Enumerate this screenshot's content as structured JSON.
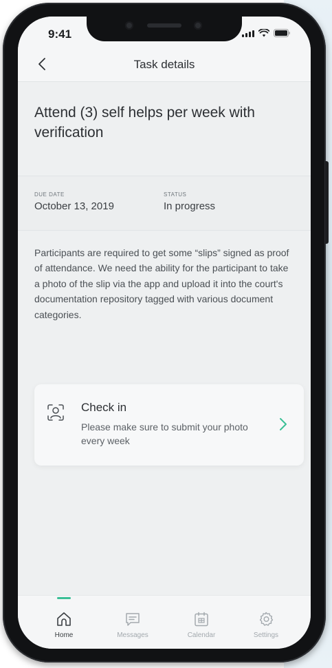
{
  "status_bar": {
    "time": "9:41"
  },
  "nav": {
    "title": "Task details",
    "back_icon": "chevron-left-icon"
  },
  "task": {
    "title": "Attend (3) self helps per week with verification",
    "due_date_label": "DUE DATE",
    "due_date_value": "October 13, 2019",
    "status_label": "STATUS",
    "status_value": "In progress",
    "description": "Participants are required to get some “slips” signed as proof of attendance. We need the ability for the participant to take a photo of the slip via the app and upload it into the court's documentation repository tagged with various document categories."
  },
  "checkin": {
    "title": "Check in",
    "subtitle": "Please make sure to submit your photo every week",
    "icon": "face-scan-icon",
    "action_icon": "chevron-right-icon"
  },
  "tabs": [
    {
      "label": "Home",
      "icon": "home-icon",
      "active": true
    },
    {
      "label": "Messages",
      "icon": "message-icon",
      "active": false
    },
    {
      "label": "Calendar",
      "icon": "calendar-icon",
      "active": false
    },
    {
      "label": "Settings",
      "icon": "gear-icon",
      "active": false
    }
  ],
  "colors": {
    "accent": "#3bbf96",
    "text_primary": "#2c2f33",
    "screen_bg": "#eef0f1"
  }
}
